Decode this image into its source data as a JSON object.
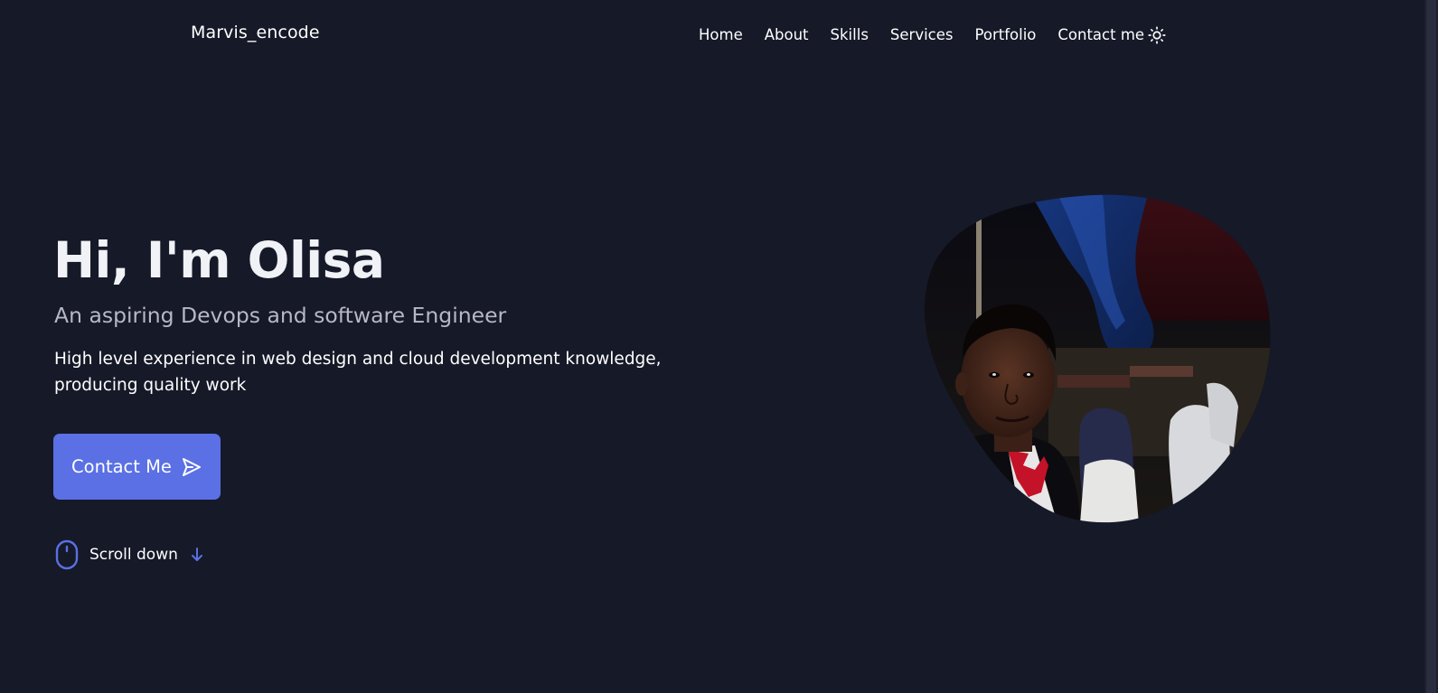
{
  "header": {
    "logo": "Marvis_encode",
    "nav": [
      {
        "label": "Home"
      },
      {
        "label": "About"
      },
      {
        "label": "Skills"
      },
      {
        "label": "Services"
      },
      {
        "label": "Portfolio"
      },
      {
        "label": "Contact me"
      }
    ],
    "theme_toggle_icon": "sun-icon"
  },
  "hero": {
    "title": "Hi, I'm Olisa",
    "subtitle": "An aspiring Devops and software Engineer",
    "description": "High level experience in web design and cloud development knowledge, producing quality work",
    "contact_button": {
      "label": "Contact Me",
      "icon": "send-icon"
    },
    "scroll": {
      "label": "Scroll down",
      "mouse_icon": "mouse-icon",
      "arrow_icon": "arrow-down-icon"
    },
    "profile_image_icon": "profile-photo"
  },
  "colors": {
    "background": "#161928",
    "accent": "#5a70e4",
    "title": "#f1f2f6",
    "subtitle": "#b6b8c6",
    "text": "#ffffff"
  }
}
